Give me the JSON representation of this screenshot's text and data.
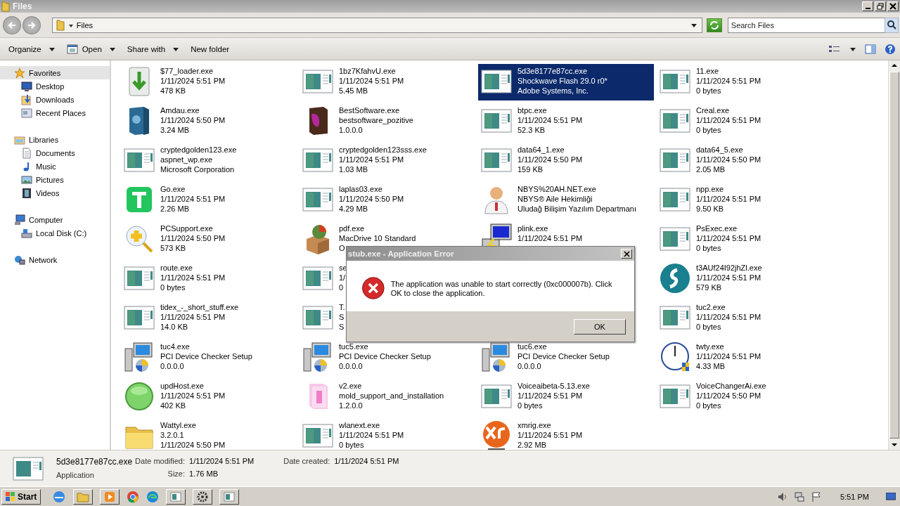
{
  "window": {
    "title": "Files"
  },
  "address": {
    "path": "Files"
  },
  "search": {
    "placeholder": "Search Files"
  },
  "toolbar": [
    {
      "label": "Organize",
      "dropdown": true,
      "icon": false
    },
    {
      "label": "Open",
      "dropdown": true,
      "icon": true
    },
    {
      "label": "Share with",
      "dropdown": true,
      "icon": false
    },
    {
      "label": "New folder",
      "dropdown": false,
      "icon": false
    }
  ],
  "sidebar": [
    {
      "label": "Favorites",
      "kind": "star",
      "selected": true,
      "children": [
        {
          "label": "Desktop",
          "kind": "desktop",
          "selected": false
        },
        {
          "label": "Downloads",
          "kind": "downloads",
          "selected": false
        },
        {
          "label": "Recent Places",
          "kind": "recent",
          "selected": false
        }
      ]
    },
    {
      "label": "Libraries",
      "kind": "libraries",
      "selected": false,
      "children": [
        {
          "label": "Documents",
          "kind": "documents",
          "selected": false
        },
        {
          "label": "Music",
          "kind": "music",
          "selected": false
        },
        {
          "label": "Pictures",
          "kind": "pictures",
          "selected": false
        },
        {
          "label": "Videos",
          "kind": "videos",
          "selected": false
        }
      ]
    },
    {
      "label": "Computer",
      "kind": "computer",
      "selected": false,
      "children": [
        {
          "label": "Local Disk (C:)",
          "kind": "disk",
          "selected": false
        }
      ]
    },
    {
      "label": "Network",
      "kind": "network",
      "selected": false
    }
  ],
  "files": [
    {
      "kind": "download",
      "lines": [
        "$77_loader.exe",
        "1/11/2024 5:51 PM",
        "478 KB"
      ],
      "selected": false
    },
    {
      "kind": "window",
      "lines": [
        "1bz7KfahvU.exe",
        "1/11/2024 5:51 PM",
        "5.45 MB"
      ],
      "selected": false
    },
    {
      "kind": "window",
      "lines": [
        "5d3e8177e87cc.exe",
        "Shockwave Flash 29.0 r0*",
        "Adobe Systems, Inc."
      ],
      "selected": true
    },
    {
      "kind": "window",
      "lines": [
        "11.exe",
        "1/11/2024 5:51 PM",
        "0 bytes"
      ],
      "selected": false
    },
    {
      "kind": "box-blue",
      "lines": [
        "Amdau.exe",
        "1/11/2024 5:50 PM",
        "3.24 MB"
      ],
      "selected": false
    },
    {
      "kind": "box-purple",
      "lines": [
        "BestSoftware.exe",
        "bestsoftware_pozitive",
        "1.0.0.0"
      ],
      "selected": false
    },
    {
      "kind": "window",
      "lines": [
        "btpc.exe",
        "1/11/2024 5:51 PM",
        "52.3 KB"
      ],
      "selected": false
    },
    {
      "kind": "window",
      "lines": [
        "Creal.exe",
        "1/11/2024 5:51 PM",
        "0 bytes"
      ],
      "selected": false
    },
    {
      "kind": "window",
      "lines": [
        "cryptedgolden123.exe",
        "aspnet_wp.exe",
        "Microsoft Corporation"
      ],
      "selected": false
    },
    {
      "kind": "window",
      "lines": [
        "cryptedgolden123sss.exe",
        "1/11/2024 5:51 PM",
        "1.03 MB"
      ],
      "selected": false
    },
    {
      "kind": "window",
      "lines": [
        "data64_1.exe",
        "1/11/2024 5:50 PM",
        "159 KB"
      ],
      "selected": false
    },
    {
      "kind": "window",
      "lines": [
        "data64_5.exe",
        "1/11/2024 5:50 PM",
        "2.05 MB"
      ],
      "selected": false
    },
    {
      "kind": "letter-t",
      "lines": [
        "Go.exe",
        "1/11/2024 5:51 PM",
        "2.26 MB"
      ],
      "selected": false
    },
    {
      "kind": "window",
      "lines": [
        "laplas03.exe",
        "1/11/2024 5:50 PM",
        "4.29 MB"
      ],
      "selected": false
    },
    {
      "kind": "person",
      "lines": [
        "NBYS%20AH.NET.exe",
        "NBYS® Aile Hekimliği",
        "Uludağ Bilişim Yazılım Departmanı"
      ],
      "selected": false
    },
    {
      "kind": "window",
      "lines": [
        "npp.exe",
        "1/11/2024 5:51 PM",
        "9.50 KB"
      ],
      "selected": false
    },
    {
      "kind": "magnifier",
      "lines": [
        "PCSupport.exe",
        "1/11/2024 5:50 PM",
        "573 KB"
      ],
      "selected": false
    },
    {
      "kind": "parcel",
      "lines": [
        "pdf.exe",
        "MacDrive 10 Standard",
        "O"
      ],
      "selected": false
    },
    {
      "kind": "terminal",
      "lines": [
        "plink.exe",
        "1/11/2024 5:51 PM"
      ],
      "selected": false
    },
    {
      "kind": "window",
      "lines": [
        "PsExec.exe",
        "1/11/2024 5:51 PM",
        "0 bytes"
      ],
      "selected": false
    },
    {
      "kind": "window",
      "lines": [
        "route.exe",
        "1/11/2024 5:51 PM",
        "0 bytes"
      ],
      "selected": false
    },
    {
      "kind": "window",
      "lines": [
        "se",
        "1/",
        "0"
      ],
      "selected": false
    },
    {
      "kind": "covered"
    },
    {
      "kind": "teal",
      "lines": [
        "t3AUf24I92jhZl.exe",
        "1/11/2024 5:51 PM",
        "579 KB"
      ],
      "selected": false
    },
    {
      "kind": "window",
      "lines": [
        "tidex_-_short_stuff.exe",
        "1/11/2024 5:51 PM",
        "14.0 KB"
      ],
      "selected": false
    },
    {
      "kind": "window",
      "lines": [
        "T.",
        "S",
        "S"
      ],
      "selected": false
    },
    {
      "kind": "covered"
    },
    {
      "kind": "window",
      "lines": [
        "tuc2.exe",
        "1/11/2024 5:51 PM",
        "0 bytes"
      ],
      "selected": false
    },
    {
      "kind": "setup",
      "lines": [
        "tuc4.exe",
        "PCI Device Checker Setup",
        "0.0.0.0"
      ],
      "selected": false
    },
    {
      "kind": "setup",
      "lines": [
        "tuc5.exe",
        "PCI Device Checker Setup",
        "0.0.0.0"
      ],
      "selected": false
    },
    {
      "kind": "setup",
      "lines": [
        "tuc6.exe",
        "PCI Device Checker Setup",
        "0.0.0.0"
      ],
      "selected": false
    },
    {
      "kind": "clock",
      "lines": [
        "twty.exe",
        "1/11/2024 5:51 PM",
        "4.33 MB"
      ],
      "selected": false
    },
    {
      "kind": "green-circle",
      "lines": [
        "updHost.exe",
        "1/11/2024 5:51 PM",
        "402 KB"
      ],
      "selected": false
    },
    {
      "kind": "pink-box",
      "lines": [
        "v2.exe",
        "mold_support_and_installation",
        "1.2.0.0"
      ],
      "selected": false
    },
    {
      "kind": "window",
      "lines": [
        "Voiceaibeta-5.13.exe",
        "1/11/2024 5:51 PM",
        "0 bytes"
      ],
      "selected": false
    },
    {
      "kind": "window",
      "lines": [
        "VoiceChangerAi.exe",
        "1/11/2024 5:50 PM",
        "0 bytes"
      ],
      "selected": false
    },
    {
      "kind": "folder",
      "lines": [
        "Wattyl.exe",
        "3.2.0.1",
        "1/11/2024 5:50 PM"
      ],
      "selected": false
    },
    {
      "kind": "window",
      "lines": [
        "wlanext.exe",
        "1/11/2024 5:51 PM",
        "0 bytes"
      ],
      "selected": false
    },
    {
      "kind": "xr",
      "lines": [
        "xmrig.exe",
        "1/11/2024 5:51 PM",
        "2.92 MB"
      ],
      "selected": false
    }
  ],
  "details": {
    "name": "5d3e8177e87cc.exe",
    "type": "Application",
    "modified_label": "Date modified:",
    "modified": "1/11/2024 5:51 PM",
    "size_label": "Size:",
    "size": "1.76 MB",
    "created_label": "Date created:",
    "created": "1/11/2024 5:51 PM"
  },
  "dialog": {
    "title": "stub.exe - Application Error",
    "message": "The application was unable to start correctly (0xc000007b). Click OK to close the application.",
    "button": "OK"
  },
  "taskbar": {
    "start": "Start",
    "clock": "5:51 PM"
  }
}
